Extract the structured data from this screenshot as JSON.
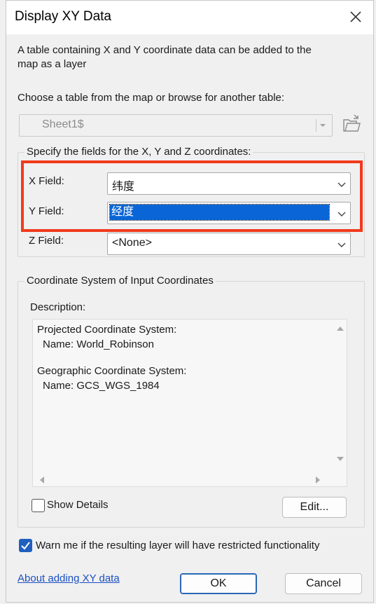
{
  "window": {
    "title": "Display XY Data"
  },
  "intro": {
    "line1": "A table containing X and Y coordinate data can be added to the",
    "line2": "map as a layer"
  },
  "table_chooser": {
    "label": "Choose a table from the map or browse for another table:",
    "selected": "Sheet1$"
  },
  "fields": {
    "group_label": "Specify the fields for the X, Y and Z coordinates:",
    "x_label": "X Field:",
    "x_value": "纬度",
    "y_label": "Y Field:",
    "y_value": "经度",
    "z_label": "Z Field:",
    "z_value": "<None>"
  },
  "coord_system": {
    "group_label": "Coordinate System of Input Coordinates",
    "description_label": "Description:",
    "lines": [
      "Projected Coordinate System:",
      "  Name: World_Robinson",
      "",
      "Geographic Coordinate System:",
      "  Name: GCS_WGS_1984"
    ],
    "show_details_label": "Show Details",
    "show_details_checked": false,
    "edit_label": "Edit..."
  },
  "warn": {
    "label": "Warn me if the resulting layer will have restricted functionality",
    "checked": true
  },
  "footer": {
    "help_link": "About adding XY data",
    "ok_label": "OK",
    "cancel_label": "Cancel"
  },
  "colors": {
    "highlight": "#f03a1c",
    "selection": "#0a66d6",
    "checkbox_checked": "#1f5fbf"
  }
}
